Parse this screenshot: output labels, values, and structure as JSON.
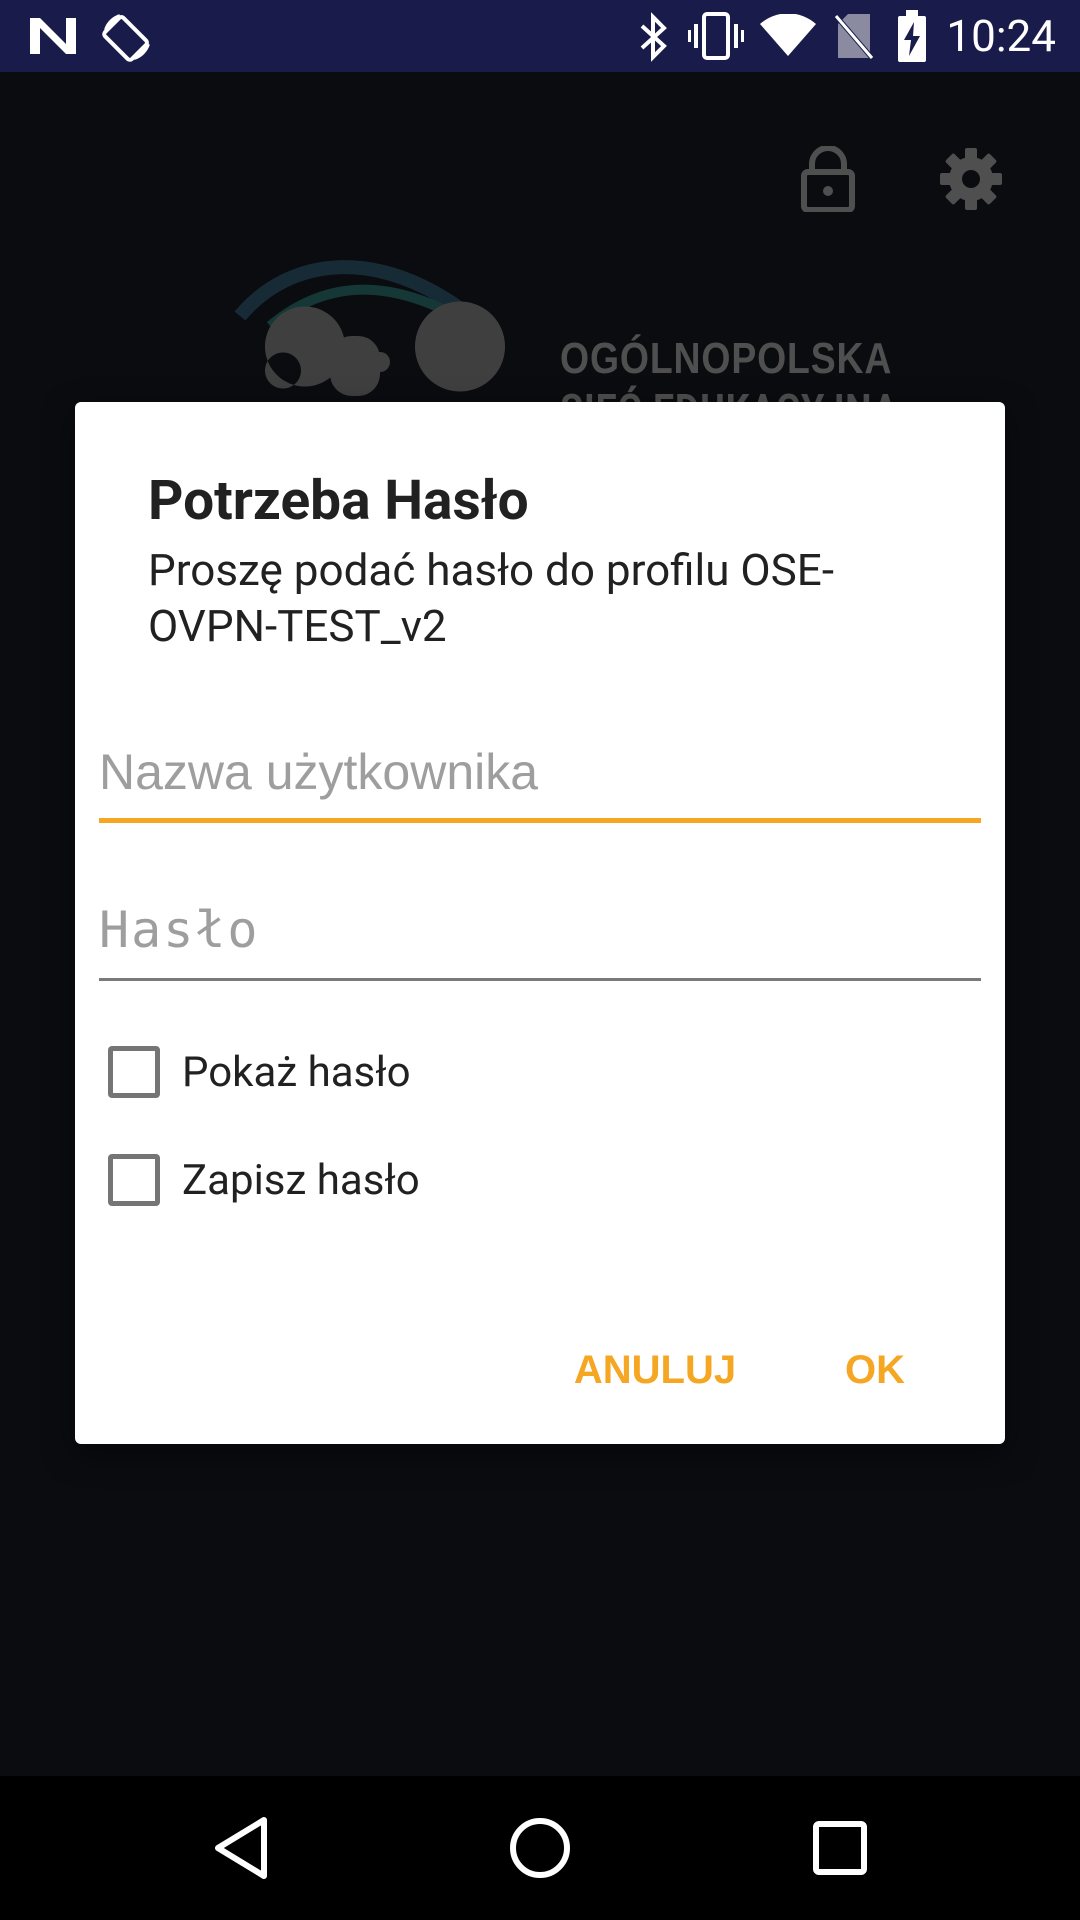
{
  "status_bar": {
    "time": "10:24",
    "icons": [
      "n-notification-icon",
      "screen-rotate-icon",
      "bluetooth-icon",
      "vibrate-icon",
      "wifi-icon",
      "no-sim-icon",
      "battery-charging-icon"
    ]
  },
  "app": {
    "top_icons": [
      "lock-icon",
      "settings-gear-icon"
    ],
    "logo_text_line1": "OGÓLNOPOLSKA",
    "logo_text_line2": "SIEĆ EDUKACYJNA"
  },
  "dialog": {
    "title": "Potrzeba Hasło",
    "message": "Proszę podać hasło do profilu OSE-OVPN-TEST_v2",
    "username_placeholder": "Nazwa użytkownika",
    "password_placeholder": "Hasło",
    "show_password_label": "Pokaż hasło",
    "save_password_label": "Zapisz hasło",
    "cancel_label": "ANULUJ",
    "ok_label": "OK"
  },
  "nav_bar": {
    "buttons": [
      "back-icon",
      "home-icon",
      "recents-icon"
    ]
  },
  "colors": {
    "accent": "#f5a623",
    "status_bar": "#191c4b",
    "background": "#0e1016"
  }
}
